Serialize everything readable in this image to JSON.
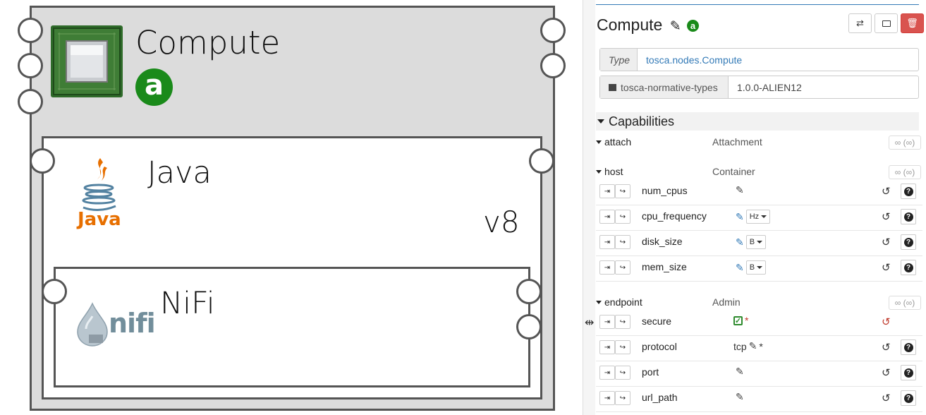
{
  "canvas": {
    "compute_node": {
      "title": "Compute",
      "badge": "a"
    },
    "java_node": {
      "title": "Java",
      "version": "v8",
      "logo_text": "Java"
    },
    "nifi_node": {
      "title": "NiFi",
      "logo_text": "nifi"
    }
  },
  "panel": {
    "title": "Compute",
    "badge": "a",
    "buttons": {
      "replace": "replace-icon",
      "details": "details-icon",
      "delete": "trash-icon"
    },
    "type_label": "Type",
    "type_value": "tosca.nodes.Compute",
    "archive_label": "tosca-normative-types",
    "archive_version": "1.0.0-ALIEN12",
    "capabilities_title": "Capabilities",
    "capabilities": [
      {
        "name": "attach",
        "type": "Attachment",
        "bounds": "∞ (∞)",
        "properties": []
      },
      {
        "name": "host",
        "type": "Container",
        "bounds": "∞ (∞)",
        "properties": [
          {
            "name": "num_cpus",
            "value": "",
            "unit": ""
          },
          {
            "name": "cpu_frequency",
            "value": "",
            "unit": "Hz"
          },
          {
            "name": "disk_size",
            "value": "",
            "unit": "B"
          },
          {
            "name": "mem_size",
            "value": "",
            "unit": "B"
          }
        ]
      },
      {
        "name": "endpoint",
        "type": "Admin",
        "bounds": "∞ (∞)",
        "properties": [
          {
            "name": "secure",
            "value": "",
            "required": "*"
          },
          {
            "name": "protocol",
            "value": "tcp",
            "required": "*"
          },
          {
            "name": "port",
            "value": ""
          },
          {
            "name": "url_path",
            "value": ""
          }
        ]
      }
    ]
  },
  "colors": {
    "accent": "#337ab7",
    "badge": "#1a8a1a",
    "danger": "#d9534f",
    "check": "#2e8b2e"
  }
}
